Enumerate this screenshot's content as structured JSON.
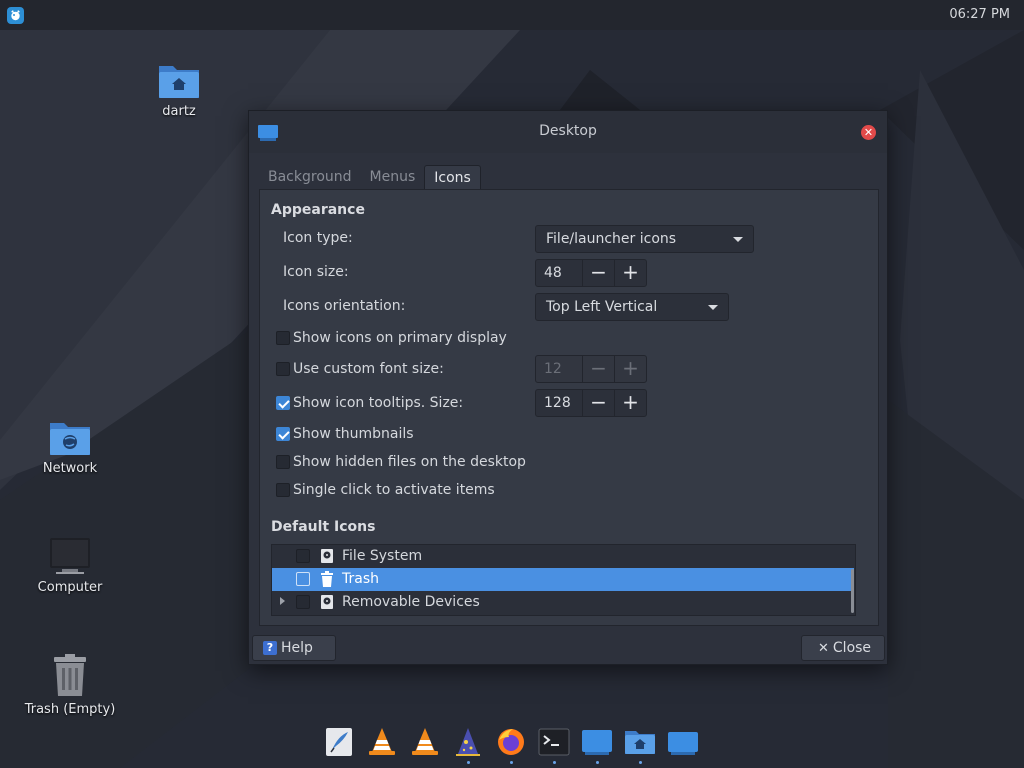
{
  "panel": {
    "clock": "06:27 PM"
  },
  "desktop_icons": [
    {
      "label": "dartz",
      "icon": "home-folder-icon"
    },
    {
      "label": "Network",
      "icon": "network-folder-icon"
    },
    {
      "label": "Computer",
      "icon": "computer-icon"
    },
    {
      "label": "Trash (Empty)",
      "icon": "trash-icon"
    }
  ],
  "dialog": {
    "title": "Desktop",
    "tabs": [
      "Background",
      "Menus",
      "Icons"
    ],
    "active_tab": "Icons",
    "appearance": {
      "title": "Appearance",
      "icon_type_label": "Icon type:",
      "icon_type_value": "File/launcher icons",
      "icon_size_label": "Icon size:",
      "icon_size_value": "48",
      "orientation_label": "Icons orientation:",
      "orientation_value": "Top Left Vertical",
      "show_primary": "Show icons on primary display",
      "custom_font": "Use custom font size:",
      "custom_font_value": "12",
      "tooltips": "Show icon tooltips. Size:",
      "tooltips_value": "128",
      "thumbnails": "Show thumbnails",
      "hidden_files": "Show hidden files on the desktop",
      "single_click": "Single click to activate items",
      "checks": {
        "show_primary": false,
        "custom_font": false,
        "tooltips": true,
        "thumbnails": true,
        "hidden_files": false,
        "single_click": false
      }
    },
    "default_icons": {
      "title": "Default Icons",
      "items": [
        {
          "label": "File System",
          "checked": false,
          "selected": false,
          "expandable": false
        },
        {
          "label": "Trash",
          "checked": false,
          "selected": true,
          "expandable": false
        },
        {
          "label": "Removable Devices",
          "checked": false,
          "selected": false,
          "expandable": true
        }
      ]
    },
    "buttons": {
      "help": "Help",
      "close": "Close"
    }
  },
  "dock_items": [
    "text-editor-icon",
    "vlc-icon",
    "vlc-icon",
    "wizard-icon",
    "firefox-icon",
    "terminal-icon",
    "window-icon",
    "home-folder-icon",
    "window-icon"
  ],
  "colors": {
    "accent": "#4a90e2",
    "close_red": "#e24a4a",
    "folder_blue": "#4a90d9"
  }
}
